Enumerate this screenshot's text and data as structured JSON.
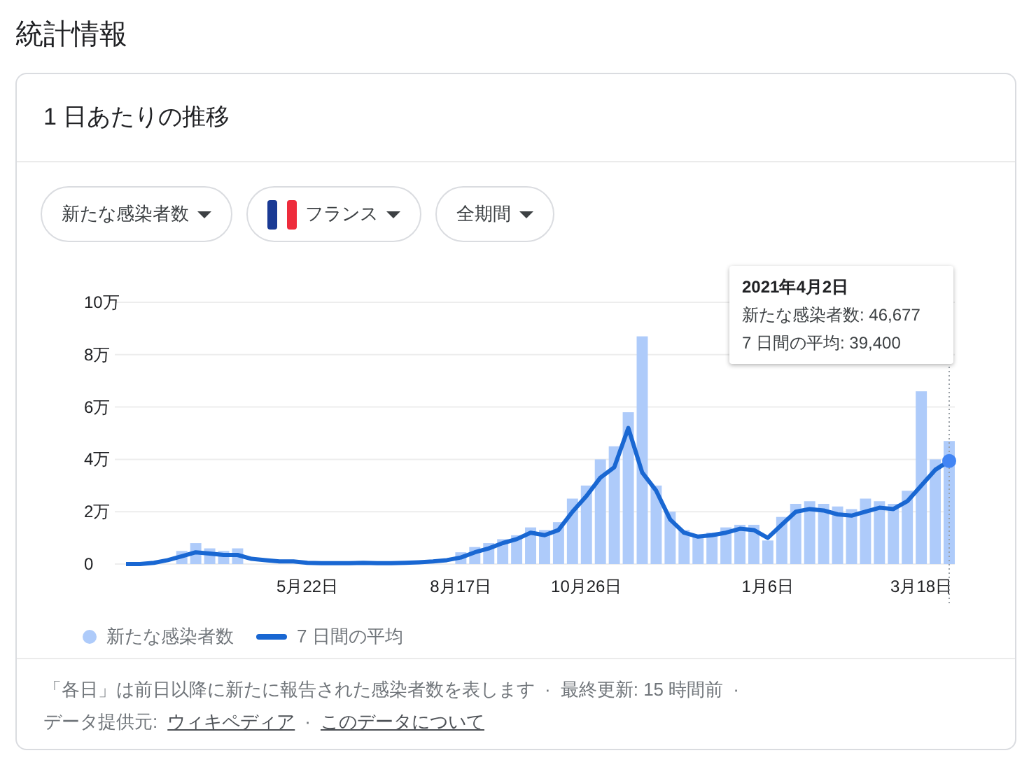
{
  "page_title": "統計情報",
  "card": {
    "title": "1 日あたりの推移",
    "filters": [
      {
        "label": "新たな感染者数",
        "kind": "plain"
      },
      {
        "label": "フランス",
        "kind": "flag"
      },
      {
        "label": "全期間",
        "kind": "plain"
      }
    ],
    "chart_data": {
      "type": "bar",
      "categories": [
        null,
        null,
        null,
        null,
        null,
        null,
        null,
        null,
        null,
        null,
        null,
        null,
        null,
        "5月22日",
        null,
        null,
        null,
        null,
        null,
        null,
        null,
        null,
        null,
        null,
        "8月17日",
        null,
        null,
        null,
        null,
        null,
        null,
        null,
        null,
        "10月26日",
        null,
        null,
        null,
        null,
        null,
        null,
        null,
        null,
        null,
        null,
        null,
        null,
        "1月6日",
        null,
        null,
        null,
        null,
        null,
        null,
        null,
        null,
        null,
        null,
        "3月18日",
        null,
        null
      ],
      "ylim": [
        0,
        10
      ],
      "grid": true,
      "yticks": [
        {
          "value": 0,
          "label": "0"
        },
        {
          "value": 2,
          "label": "2万"
        },
        {
          "value": 4,
          "label": "4万"
        },
        {
          "value": 6,
          "label": "6万"
        },
        {
          "value": 8,
          "label": "8万"
        },
        {
          "value": 10,
          "label": "10万"
        }
      ],
      "series": [
        {
          "name": "新たな感染者数",
          "type": "bar",
          "color": "#aecbfa",
          "values": [
            0,
            0,
            0,
            0,
            0.5,
            0.8,
            0.6,
            0.5,
            0.6,
            0,
            0,
            0,
            0,
            0,
            0,
            0,
            0,
            0,
            0,
            0,
            0,
            0,
            0,
            0,
            0.45,
            0.65,
            0.8,
            0.95,
            1.1,
            1.4,
            1.3,
            1.6,
            2.5,
            3,
            4,
            4.5,
            5.8,
            8.7,
            3,
            2,
            1.3,
            1.1,
            1.2,
            1.4,
            1.5,
            1.5,
            0.9,
            1.8,
            2.3,
            2.4,
            2.3,
            2.2,
            2.1,
            2.5,
            2.4,
            2.3,
            2.8,
            6.6,
            4,
            4.7
          ]
        },
        {
          "name": "7 日間の平均",
          "type": "line",
          "color": "#1967d2",
          "values": [
            0,
            0,
            0.05,
            0.15,
            0.3,
            0.45,
            0.4,
            0.35,
            0.35,
            0.2,
            0.15,
            0.1,
            0.1,
            0.05,
            0.03,
            0.03,
            0.03,
            0.05,
            0.03,
            0.03,
            0.05,
            0.07,
            0.1,
            0.15,
            0.25,
            0.45,
            0.6,
            0.8,
            0.95,
            1.2,
            1.1,
            1.3,
            2,
            2.6,
            3.3,
            3.7,
            5.2,
            3.5,
            2.8,
            1.7,
            1.2,
            1.05,
            1.1,
            1.2,
            1.35,
            1.3,
            1,
            1.5,
            2,
            2.1,
            2.05,
            1.9,
            1.85,
            2,
            2.15,
            2.1,
            2.4,
            3,
            3.6,
            3.94
          ]
        }
      ]
    },
    "tooltip": {
      "date": "2021年4月2日",
      "lines": [
        "新たな感染者数: 46,677",
        "7 日間の平均: 39,400"
      ]
    },
    "footer": {
      "lines": [
        [
          {
            "kind": "text",
            "text": "「各日」は前日以降に新たに報告された感染者数を表します"
          },
          {
            "kind": "sep",
            "text": "·"
          },
          {
            "kind": "text",
            "text": "最終更新: 15 時間前"
          },
          {
            "kind": "sep",
            "text": "·"
          }
        ],
        [
          {
            "kind": "text",
            "text": "データ提供元:"
          },
          {
            "kind": "link",
            "text": "ウィキペディア"
          },
          {
            "kind": "sep",
            "text": "·"
          },
          {
            "kind": "link",
            "text": "このデータについて"
          }
        ]
      ]
    }
  }
}
